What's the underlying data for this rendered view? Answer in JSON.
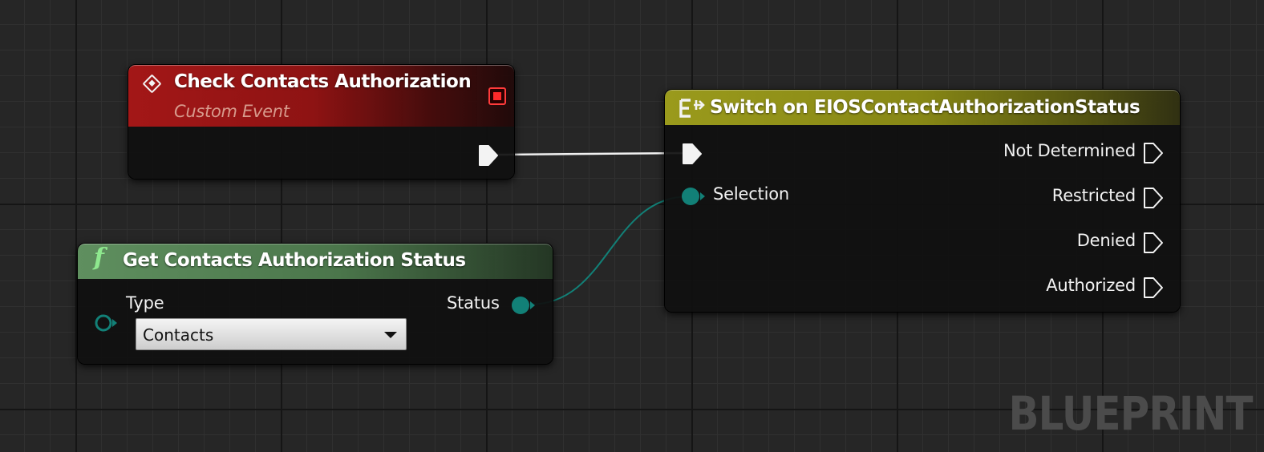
{
  "watermark": "BLUEPRINT",
  "colors": {
    "event_header": "#9b1414",
    "function_header": "#4e7a4e",
    "switch_header": "#8c8c16",
    "exec_wire": "#f0f0f0",
    "enum_pin": "#128077"
  },
  "event_node": {
    "icon": "custom-event-icon",
    "title": "Check Contacts Authorization",
    "subtitle": "Custom Event",
    "stop_icon": "breakpoint-stop-icon"
  },
  "function_node": {
    "icon": "function-icon",
    "icon_glyph": "f",
    "title": "Get Contacts Authorization Status",
    "input_label": "Type",
    "dropdown_value": "Contacts",
    "output_label": "Status"
  },
  "switch_node": {
    "icon": "switch-enum-icon",
    "title": "Switch on EIOSContactAuthorizationStatus",
    "selection_label": "Selection",
    "outputs": [
      "Not Determined",
      "Restricted",
      "Denied",
      "Authorized"
    ]
  }
}
